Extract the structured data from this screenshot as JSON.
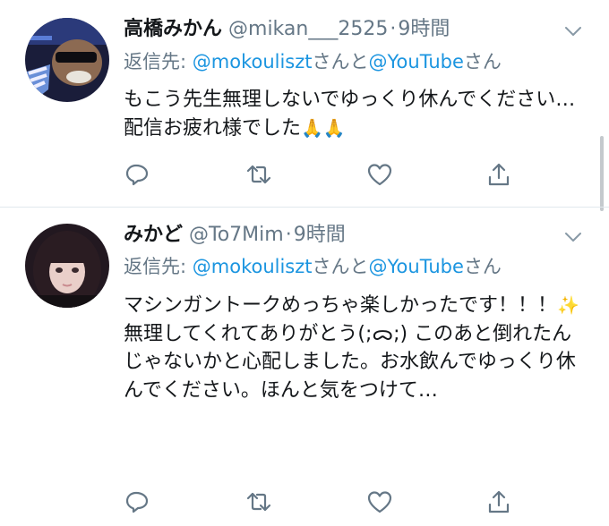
{
  "tweets": [
    {
      "display_name": "高橋みかん",
      "handle": "@mikan___2525",
      "separator": "·",
      "time": "9時間",
      "reply_prefix": "返信先: ",
      "reply_to_1": "@mokouliszt",
      "reply_mid": "さんと",
      "reply_to_2": "@YouTube",
      "reply_suffix": "さん",
      "body_main": "もこう先生無理しないでゆっくり休んでください…配信お疲れ様でした",
      "body_emoji": "🙏🙏",
      "actions": [
        "reply",
        "retweet",
        "like",
        "share"
      ]
    },
    {
      "display_name": "みかど",
      "handle": "@To7Mim",
      "separator": "·",
      "time": "9時間",
      "reply_prefix": "返信先: ",
      "reply_to_1": "@mokouliszt",
      "reply_mid": "さんと",
      "reply_to_2": "@YouTube",
      "reply_suffix": "さん",
      "body_line1": "マシンガントークめっちゃ楽しかったです！！！",
      "body_emoji": "✨",
      "body_rest": "無理してくれてありがとう(;ᯅ;) このあと倒れたんじゃないかと心配しました。お水飲んでゆっくり休んでください。ほんと気をつけて…",
      "actions": [
        "reply",
        "retweet",
        "like",
        "share"
      ]
    }
  ],
  "colors": {
    "text": "#14171a",
    "secondary": "#657786",
    "link": "#1b95e0",
    "divider": "#e1e8ed"
  }
}
